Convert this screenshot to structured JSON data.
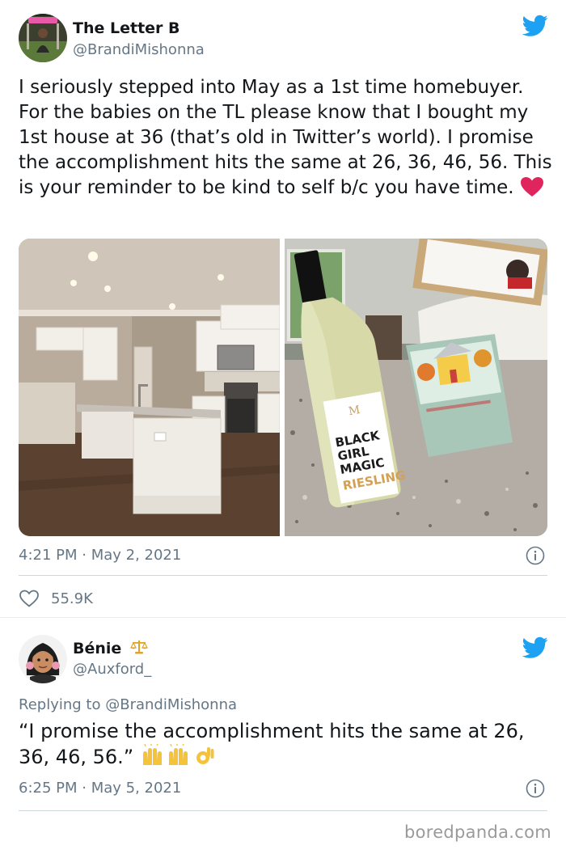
{
  "tweet1": {
    "author_name": "The Letter B",
    "author_handle": "@BrandiMishonna",
    "text": "I seriously stepped into May as a 1st time homebuyer. For the babies on the TL please know that I bought my 1st house at 36 (that’s old in Twitter’s world). I promise the accomplishment hits the same at 26, 36, 46, 56. This is your reminder to be kind to self b/c you have time.",
    "text_emoji": "red-heart",
    "timestamp": "4:21 PM · May 2, 2021",
    "likes": "55.9K",
    "media": [
      {
        "name": "kitchen-photo",
        "icon": "image"
      },
      {
        "name": "wine-and-card-photo",
        "icon": "image",
        "bottle_label": [
          "BLACK",
          "GIRL",
          "MAGIC",
          "RIESLING"
        ],
        "bottle_brand": "M"
      }
    ]
  },
  "tweet2": {
    "author_name": "Bénie",
    "author_badge": "scales-emoji",
    "author_handle": "@Auxford_",
    "replying_prefix": "Replying to",
    "replying_to": "@BrandiMishonna",
    "text": "“I promise the accomplishment hits the same at 26, 36, 46, 56.”",
    "text_emoji": [
      "raising-hands",
      "raising-hands",
      "ok-hand"
    ],
    "timestamp": "6:25 PM · May 5, 2021"
  },
  "watermark": "boredpanda.com",
  "colors": {
    "twitter_blue": "#1da1f2",
    "secondary_text": "#657786",
    "primary_text": "#14171a",
    "heart_red": "#e0245e"
  }
}
